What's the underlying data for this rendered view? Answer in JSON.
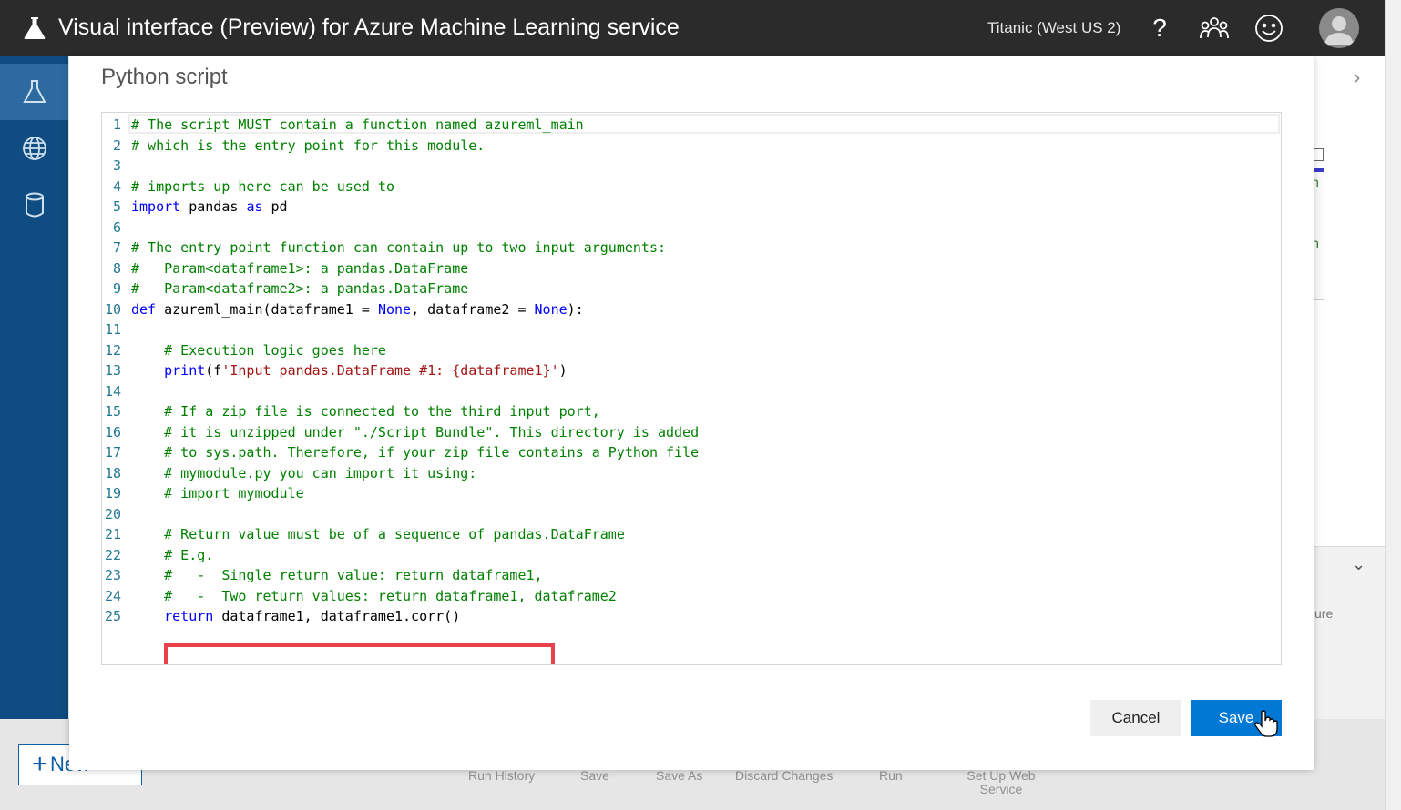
{
  "header": {
    "title": "Visual interface (Preview) for Azure Machine Learning service",
    "workspace": "Titanic (West US 2)",
    "help_glyph": "?"
  },
  "sidebar": {
    "items": [
      {
        "icon": "flask-icon",
        "active": true
      },
      {
        "icon": "globe-icon",
        "active": false
      },
      {
        "icon": "database-icon",
        "active": false
      }
    ]
  },
  "modal": {
    "title": "Python script",
    "cancel_label": "Cancel",
    "save_label": "Save",
    "code_lines": [
      {
        "num": "1",
        "parts": [
          {
            "t": "# The script MUST contain a function named azureml_main",
            "c": "cm"
          }
        ]
      },
      {
        "num": "2",
        "parts": [
          {
            "t": "# which is the entry point for this module.",
            "c": "cm"
          }
        ]
      },
      {
        "num": "3",
        "parts": []
      },
      {
        "num": "4",
        "parts": [
          {
            "t": "# imports up here can be used to",
            "c": "cm"
          }
        ]
      },
      {
        "num": "5",
        "parts": [
          {
            "t": "import",
            "c": "kw"
          },
          {
            "t": " pandas ",
            "c": "tx"
          },
          {
            "t": "as",
            "c": "kw"
          },
          {
            "t": " pd",
            "c": "tx"
          }
        ]
      },
      {
        "num": "6",
        "parts": []
      },
      {
        "num": "7",
        "parts": [
          {
            "t": "# The entry point function can contain up to two input arguments:",
            "c": "cm"
          }
        ]
      },
      {
        "num": "8",
        "parts": [
          {
            "t": "#   Param<dataframe1>: a pandas.DataFrame",
            "c": "cm"
          }
        ]
      },
      {
        "num": "9",
        "parts": [
          {
            "t": "#   Param<dataframe2>: a pandas.DataFrame",
            "c": "cm"
          }
        ]
      },
      {
        "num": "10",
        "parts": [
          {
            "t": "def",
            "c": "kw"
          },
          {
            "t": " azureml_main(dataframe1 = ",
            "c": "tx"
          },
          {
            "t": "None",
            "c": "kw"
          },
          {
            "t": ", dataframe2 = ",
            "c": "tx"
          },
          {
            "t": "None",
            "c": "kw"
          },
          {
            "t": "):",
            "c": "tx"
          }
        ]
      },
      {
        "num": "11",
        "parts": []
      },
      {
        "num": "12",
        "parts": [
          {
            "t": "    # Execution logic goes here",
            "c": "cm"
          }
        ]
      },
      {
        "num": "13",
        "parts": [
          {
            "t": "    ",
            "c": "tx"
          },
          {
            "t": "print",
            "c": "kw"
          },
          {
            "t": "(f",
            "c": "tx"
          },
          {
            "t": "'Input pandas.DataFrame #1: {dataframe1}'",
            "c": "st"
          },
          {
            "t": ")",
            "c": "tx"
          }
        ]
      },
      {
        "num": "14",
        "parts": []
      },
      {
        "num": "15",
        "parts": [
          {
            "t": "    # If a zip file is connected to the third input port,",
            "c": "cm"
          }
        ]
      },
      {
        "num": "16",
        "parts": [
          {
            "t": "    # it is unzipped under \"./Script Bundle\". This directory is added",
            "c": "cm"
          }
        ]
      },
      {
        "num": "17",
        "parts": [
          {
            "t": "    # to sys.path. Therefore, if your zip file contains a Python file",
            "c": "cm"
          }
        ]
      },
      {
        "num": "18",
        "parts": [
          {
            "t": "    # mymodule.py you can import it using:",
            "c": "cm"
          }
        ]
      },
      {
        "num": "19",
        "parts": [
          {
            "t": "    # import mymodule",
            "c": "cm"
          }
        ]
      },
      {
        "num": "20",
        "parts": []
      },
      {
        "num": "21",
        "parts": [
          {
            "t": "    # Return value must be of a sequence of pandas.DataFrame",
            "c": "cm"
          }
        ]
      },
      {
        "num": "22",
        "parts": [
          {
            "t": "    # E.g.",
            "c": "cm"
          }
        ]
      },
      {
        "num": "23",
        "parts": [
          {
            "t": "    #   -  Single return value: return dataframe1,",
            "c": "cm"
          }
        ]
      },
      {
        "num": "24",
        "parts": [
          {
            "t": "    #   -  Two return values: return dataframe1, dataframe2",
            "c": "cm"
          }
        ]
      },
      {
        "num": "25",
        "parts": [
          {
            "t": "    ",
            "c": "tx"
          },
          {
            "t": "return",
            "c": "kw"
          },
          {
            "t": " dataframe1, dataframe1.corr()",
            "c": "tx"
          }
        ]
      }
    ]
  },
  "background": {
    "new_label": "New",
    "partial_text": "ure",
    "partial_n": "n",
    "toolbar": [
      "Run History",
      "Save",
      "Save As",
      "Discard Changes",
      "Run",
      "Set Up Web Service"
    ]
  },
  "colors": {
    "topbar": "#2b2b2b",
    "sidebar": "#0f4c81",
    "save_button": "#0078d4",
    "highlight": "#e8414a"
  }
}
